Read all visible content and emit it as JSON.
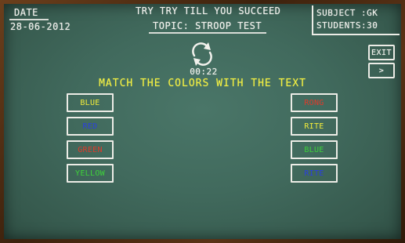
{
  "header": {
    "date_label": "DATE",
    "date_value": "28-06-2012",
    "app_title": "TRY TRY TILL YOU SUCCEED",
    "topic": "TOPIC: STROOP TEST",
    "subject": "SUBJECT  :GK",
    "students": "STUDENTS:30"
  },
  "controls": {
    "exit_label": "EXIT",
    "next_label": ">",
    "refresh_icon": "refresh-icon",
    "timer": "00:22"
  },
  "instruction": "MATCH THE COLORS WITH THE TEXT",
  "left_words": [
    {
      "text": "BLUE",
      "color": "#f2ec3a"
    },
    {
      "text": "RED",
      "color": "#2b3fe0"
    },
    {
      "text": "GREEN",
      "color": "#e03a2a"
    },
    {
      "text": "YELLOW",
      "color": "#3ed23a"
    }
  ],
  "right_words": [
    {
      "text": "RONG",
      "color": "#e03a2a"
    },
    {
      "text": "RITE",
      "color": "#f2ec3a"
    },
    {
      "text": "BLUE",
      "color": "#3ed23a"
    },
    {
      "text": "RITE",
      "color": "#2b3fe0"
    }
  ],
  "colors": {
    "board": "#416a5d",
    "chalk": "#f1f1ec",
    "instruction": "#f3ef3e",
    "frame": "#5a3316"
  }
}
